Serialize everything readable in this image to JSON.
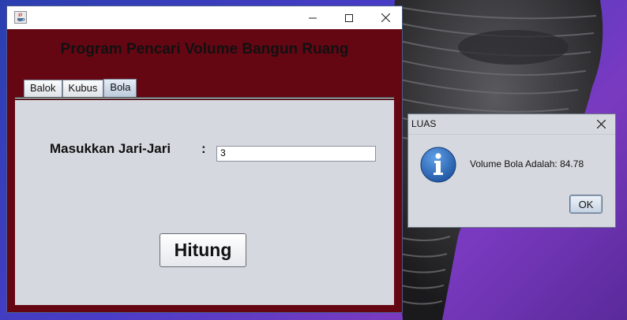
{
  "main_window": {
    "heading": "Program Pencari Volume Bangun Ruang",
    "tabs": [
      {
        "label": "Balok",
        "active": false
      },
      {
        "label": "Kubus",
        "active": false
      },
      {
        "label": "Bola",
        "active": true
      }
    ],
    "form": {
      "radius_label": "Masukkan Jari-Jari",
      "colon": ":",
      "radius_value": "3",
      "calculate_label": "Hitung"
    },
    "icons": {
      "app": "java-cup-icon",
      "minimize": "minimize-icon",
      "maximize": "maximize-icon",
      "close": "close-icon"
    }
  },
  "dialog": {
    "title": "LUAS",
    "message": "Volume Bola Adalah: 84.78",
    "ok_label": "OK",
    "icon": "info-icon"
  },
  "colors": {
    "window_content_bg": "#650713",
    "panel_bg": "#d5d8de",
    "info_icon": "#1f63b8"
  }
}
